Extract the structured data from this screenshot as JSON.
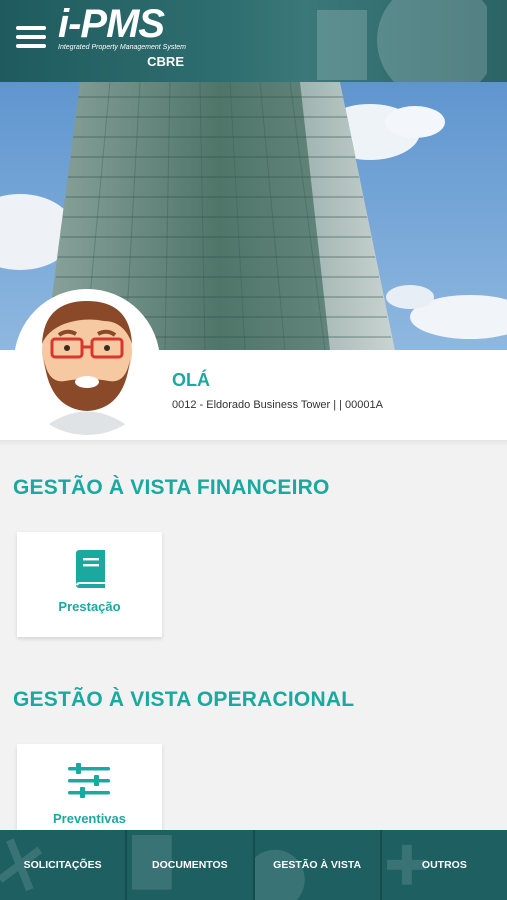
{
  "header": {
    "brand": "i-PMS",
    "tagline": "Integrated Property Management System",
    "company": "CBRE"
  },
  "profile": {
    "greeting": "OLÁ",
    "building": "0012 - Eldorado Business Tower | | 00001A"
  },
  "sections": [
    {
      "title": "GESTÃO À VISTA FINANCEIRO",
      "cards": [
        {
          "label": "Prestação",
          "icon": "book-icon"
        }
      ]
    },
    {
      "title": "GESTÃO À VISTA OPERACIONAL",
      "cards": [
        {
          "label": "Preventivas",
          "icon": "sliders-icon"
        }
      ]
    }
  ],
  "bottom_nav": [
    {
      "label": "SOLICITAÇÕES"
    },
    {
      "label": "DOCUMENTOS"
    },
    {
      "label": "GESTÃO À VISTA"
    },
    {
      "label": "OUTROS"
    }
  ],
  "colors": {
    "accent": "#1ba99f",
    "header": "#2a6668",
    "nav": "#1e5f62"
  }
}
